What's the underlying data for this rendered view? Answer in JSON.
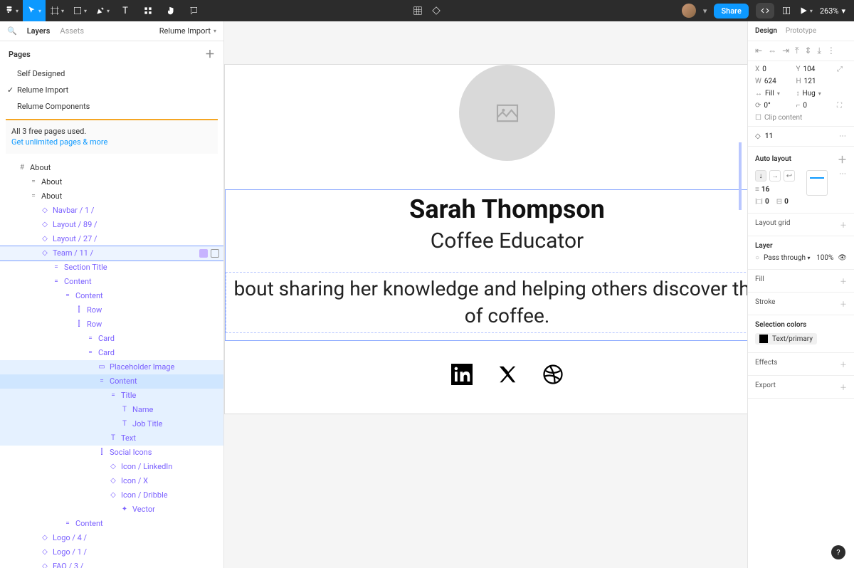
{
  "toolbar": {
    "share_label": "Share",
    "zoom": "263%"
  },
  "left": {
    "tab_layers": "Layers",
    "tab_assets": "Assets",
    "filename": "Relume Import",
    "pages_header": "Pages",
    "pages": [
      "Self Designed",
      "Relume Import",
      "Relume Components"
    ],
    "free_line1": "All 3 free pages used.",
    "free_link": "Get unlimited pages & more",
    "layers": [
      {
        "l": "About",
        "i": "#",
        "d": 0
      },
      {
        "l": "About",
        "i": "=",
        "d": 1
      },
      {
        "l": "About",
        "i": "=",
        "d": 1
      },
      {
        "l": "Navbar / 1 /",
        "i": "◇",
        "d": 2,
        "p": 1
      },
      {
        "l": "Layout / 89 /",
        "i": "◇",
        "d": 2,
        "p": 1
      },
      {
        "l": "Layout / 27 /",
        "i": "◇",
        "d": 2,
        "p": 1
      },
      {
        "l": "Team / 11 /",
        "i": "◇",
        "d": 2,
        "p": 1,
        "sel": 2,
        "vis": 1
      },
      {
        "l": "Section Title",
        "i": "=",
        "d": 3,
        "p": 1
      },
      {
        "l": "Content",
        "i": "=",
        "d": 3,
        "p": 1
      },
      {
        "l": "Content",
        "i": "=",
        "d": 4,
        "p": 1
      },
      {
        "l": "Row",
        "i": "⫿",
        "d": 5,
        "p": 1
      },
      {
        "l": "Row",
        "i": "⫿",
        "d": 5,
        "p": 1
      },
      {
        "l": "Card",
        "i": "=",
        "d": 6,
        "p": 1
      },
      {
        "l": "Card",
        "i": "=",
        "d": 6,
        "p": 1
      },
      {
        "l": "Placeholder Image",
        "i": "▭",
        "d": 7,
        "p": 1,
        "sel": 1
      },
      {
        "l": "Content",
        "i": "=",
        "d": 7,
        "p": 1,
        "sel": 3
      },
      {
        "l": "Title",
        "i": "=",
        "d": 8,
        "p": 1,
        "sel": 1
      },
      {
        "l": "Name",
        "i": "T",
        "d": 9,
        "p": 1,
        "sel": 1
      },
      {
        "l": "Job Title",
        "i": "T",
        "d": 9,
        "p": 1,
        "sel": 1
      },
      {
        "l": "Text",
        "i": "T",
        "d": 8,
        "p": 1,
        "sel": 1
      },
      {
        "l": "Social Icons",
        "i": "⫿",
        "d": 7,
        "p": 1
      },
      {
        "l": "Icon / LinkedIn",
        "i": "◇",
        "d": 8,
        "p": 1
      },
      {
        "l": "Icon / X",
        "i": "◇",
        "d": 8,
        "p": 1
      },
      {
        "l": "Icon / Dribble",
        "i": "◇",
        "d": 8,
        "p": 1
      },
      {
        "l": "Vector",
        "i": "✦",
        "d": 9,
        "p": 1
      },
      {
        "l": "Content",
        "i": "=",
        "d": 4,
        "p": 1
      },
      {
        "l": "Logo / 4 /",
        "i": "◇",
        "d": 2,
        "p": 1
      },
      {
        "l": "Logo / 1 /",
        "i": "◇",
        "d": 2,
        "p": 1
      },
      {
        "l": "FAQ / 3 /",
        "i": "◇",
        "d": 2,
        "p": 1
      }
    ]
  },
  "canvas": {
    "name": "Sarah Thompson",
    "job": "Coffee Educator",
    "bio1": "bout sharing her knowledge and helping others discover the w",
    "bio2": "of coffee."
  },
  "right": {
    "tab_design": "Design",
    "tab_prototype": "Prototype",
    "x_label": "X",
    "x_val": "0",
    "y_label": "Y",
    "y_val": "104",
    "w_label": "W",
    "w_val": "624",
    "h_label": "H",
    "h_val": "121",
    "hor": "Fill",
    "ver": "Hug",
    "rot": "0°",
    "rad": "0",
    "clip": "Clip content",
    "instance": "11",
    "autolayout": "Auto layout",
    "gap": "16",
    "padH": "0",
    "padV": "0",
    "layout_grid": "Layout grid",
    "layer": "Layer",
    "pass": "Pass through",
    "opacity": "100%",
    "fill": "Fill",
    "stroke": "Stroke",
    "selcolors": "Selection colors",
    "selcolor1": "Text/primary",
    "effects": "Effects",
    "export": "Export"
  }
}
